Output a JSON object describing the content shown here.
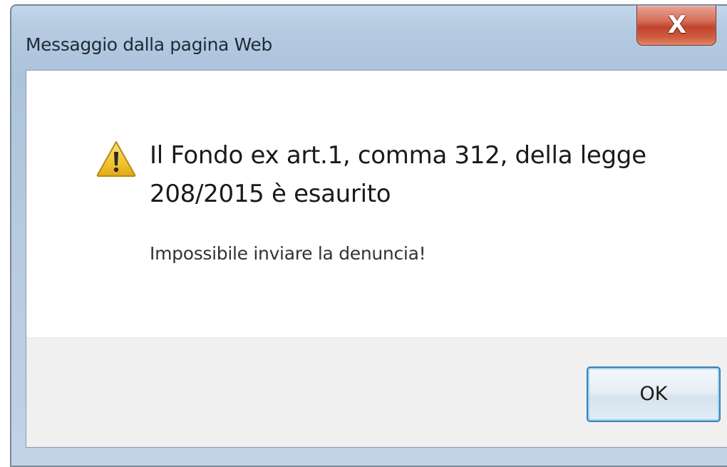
{
  "window": {
    "title": "Messaggio dalla pagina Web",
    "close_icon": "close-icon",
    "close_glyph": "X"
  },
  "dialog": {
    "icon": "warning-icon",
    "main_message": "Il Fondo ex art.1, comma 312, della legge 208/2015 è esaurito",
    "sub_message": "Impossibile inviare la denuncia!"
  },
  "buttons": {
    "ok_label": "OK"
  },
  "colors": {
    "close_button": "#c0432c",
    "ok_button_border": "#3c7fb1",
    "warning_fill": "#f2c431"
  }
}
